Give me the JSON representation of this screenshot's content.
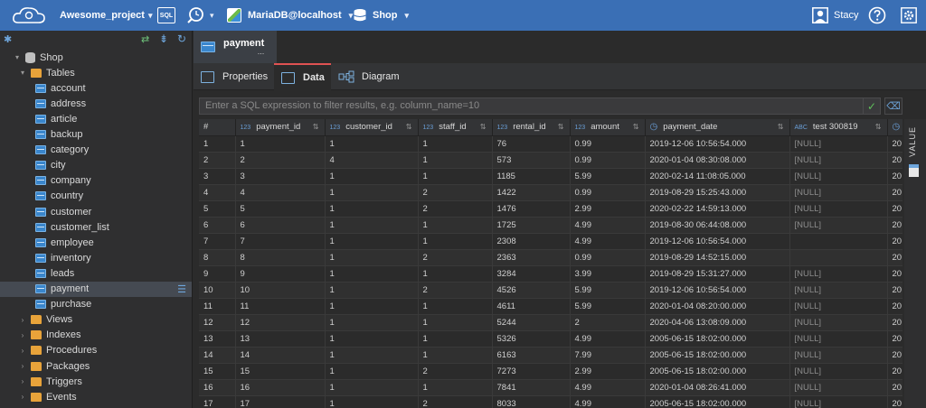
{
  "topbar": {
    "project": "Awesome_project",
    "sql_label": "SQL",
    "connection": "MariaDB@localhost",
    "database": "Shop",
    "user": "Stacy"
  },
  "sidebar": {
    "root": "Shop",
    "tables_folder": "Tables",
    "tables": [
      "account",
      "address",
      "article",
      "backup",
      "category",
      "city",
      "company",
      "country",
      "customer",
      "customer_list",
      "employee",
      "inventory",
      "leads",
      "payment",
      "purchase"
    ],
    "selected_table": "payment",
    "folders": [
      "Views",
      "Indexes",
      "Procedures",
      "Packages",
      "Triggers",
      "Events"
    ]
  },
  "editor": {
    "tab_title": "payment",
    "tab_more": "...",
    "subtabs": [
      "Properties",
      "Data",
      "Diagram"
    ],
    "active_subtab": "Data",
    "filter_placeholder": "Enter a SQL expression to filter results, e.g. column_name=10"
  },
  "grid": {
    "columns": [
      {
        "name": "#",
        "type": ""
      },
      {
        "name": "payment_id",
        "type": "123"
      },
      {
        "name": "customer_id",
        "type": "123"
      },
      {
        "name": "staff_id",
        "type": "123"
      },
      {
        "name": "rental_id",
        "type": "123"
      },
      {
        "name": "amount",
        "type": "123"
      },
      {
        "name": "payment_date",
        "type": "clock"
      },
      {
        "name": "test 300819",
        "type": "ABC"
      },
      {
        "name": "",
        "type": "clock"
      }
    ],
    "rows": [
      [
        "1",
        "1",
        "1",
        "1",
        "76",
        "0.99",
        "2019-12-06 10:56:54.000",
        "[NULL]",
        "20"
      ],
      [
        "2",
        "2",
        "4",
        "1",
        "573",
        "0.99",
        "2020-01-04 08:30:08.000",
        "[NULL]",
        "20"
      ],
      [
        "3",
        "3",
        "1",
        "1",
        "1185",
        "5.99",
        "2020-02-14 11:08:05.000",
        "[NULL]",
        "20"
      ],
      [
        "4",
        "4",
        "1",
        "2",
        "1422",
        "0.99",
        "2019-08-29 15:25:43.000",
        "[NULL]",
        "20"
      ],
      [
        "5",
        "5",
        "1",
        "2",
        "1476",
        "2.99",
        "2020-02-22 14:59:13.000",
        "[NULL]",
        "20"
      ],
      [
        "6",
        "6",
        "1",
        "1",
        "1725",
        "4.99",
        "2019-08-30 06:44:08.000",
        "[NULL]",
        "20"
      ],
      [
        "7",
        "7",
        "1",
        "1",
        "2308",
        "4.99",
        "2019-12-06 10:56:54.000",
        "",
        "20"
      ],
      [
        "8",
        "8",
        "1",
        "2",
        "2363",
        "0.99",
        "2019-08-29 14:52:15.000",
        "",
        "20"
      ],
      [
        "9",
        "9",
        "1",
        "1",
        "3284",
        "3.99",
        "2019-08-29 15:31:27.000",
        "[NULL]",
        "20"
      ],
      [
        "10",
        "10",
        "1",
        "2",
        "4526",
        "5.99",
        "2019-12-06 10:56:54.000",
        "[NULL]",
        "20"
      ],
      [
        "11",
        "11",
        "1",
        "1",
        "4611",
        "5.99",
        "2020-01-04 08:20:00.000",
        "[NULL]",
        "20"
      ],
      [
        "12",
        "12",
        "1",
        "1",
        "5244",
        "2",
        "2020-04-06 13:08:09.000",
        "[NULL]",
        "20"
      ],
      [
        "13",
        "13",
        "1",
        "1",
        "5326",
        "4.99",
        "2005-06-15 18:02:00.000",
        "[NULL]",
        "20"
      ],
      [
        "14",
        "14",
        "1",
        "1",
        "6163",
        "7.99",
        "2005-06-15 18:02:00.000",
        "[NULL]",
        "20"
      ],
      [
        "15",
        "15",
        "1",
        "2",
        "7273",
        "2.99",
        "2005-06-15 18:02:00.000",
        "[NULL]",
        "20"
      ],
      [
        "16",
        "16",
        "1",
        "1",
        "7841",
        "4.99",
        "2020-01-04 08:26:41.000",
        "[NULL]",
        "20"
      ],
      [
        "17",
        "17",
        "1",
        "2",
        "8033",
        "4.99",
        "2005-06-15 18:02:00.000",
        "[NULL]",
        "20"
      ]
    ]
  },
  "right_panel": {
    "label": "VALUE"
  },
  "colors": {
    "topbar": "#3a6fb5",
    "active_tab_accent": "#e05252",
    "selection": "#454a52"
  }
}
